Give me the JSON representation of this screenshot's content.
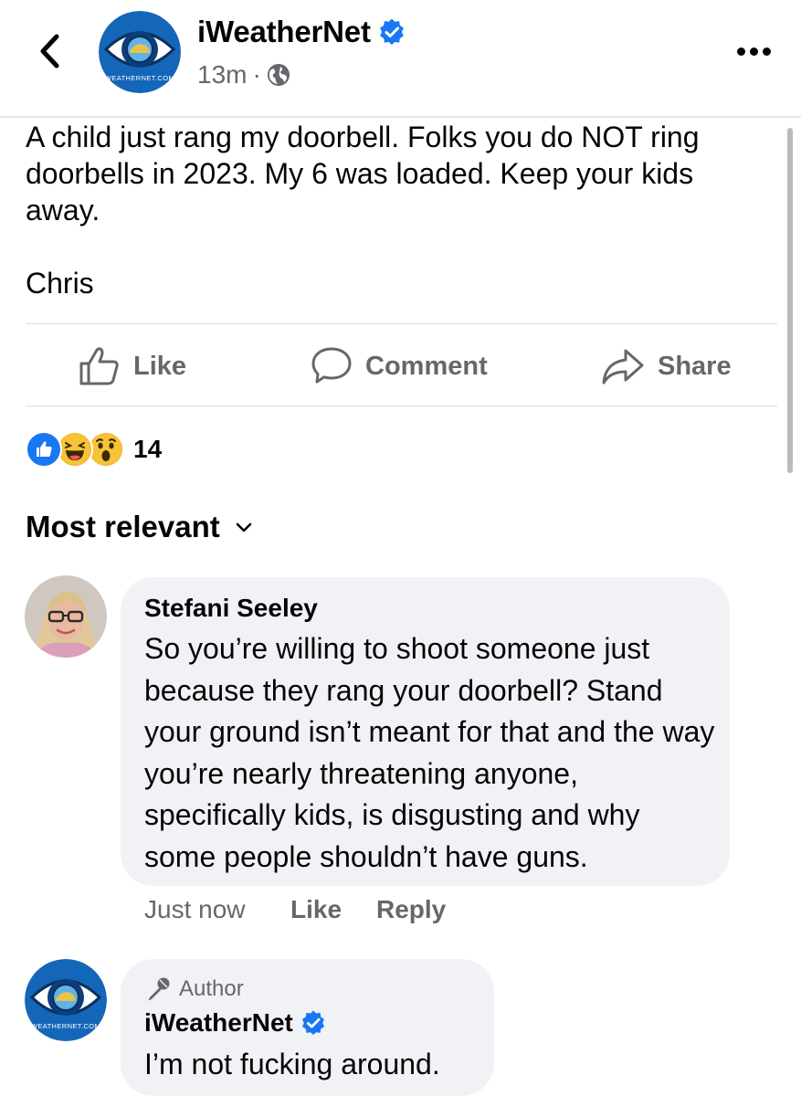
{
  "header": {
    "page_name": "iWeatherNet",
    "verified": true,
    "time": "13m",
    "separator": "·",
    "audience_icon": "globe-icon",
    "avatar_text": "WEATHERNET.COM"
  },
  "post": {
    "text": "A child just rang my doorbell. Folks you do NOT ring doorbells in 2023. My 6 was loaded. Keep your kids away.\n\nChris"
  },
  "actions": {
    "like": "Like",
    "comment": "Comment",
    "share": "Share"
  },
  "reactions": {
    "icons": [
      "like-reaction-icon",
      "haha-reaction-icon",
      "wow-reaction-icon"
    ],
    "count": "14"
  },
  "comments_sort": {
    "label": "Most relevant"
  },
  "comments": [
    {
      "author": "Stefani Seeley",
      "text": "So you’re willing to shoot someone just because they rang your doorbell? Stand your ground isn’t meant for that and the way you’re nearly threatening anyone, specifically kids, is disgusting and why some people shouldn’t have guns.",
      "time": "Just now",
      "like": "Like",
      "reply": "Reply"
    },
    {
      "badge": "Author",
      "author": "iWeatherNet",
      "verified": true,
      "text": "I’m not fucking around."
    }
  ],
  "colors": {
    "verified_blue": "#1877f2",
    "secondary_text": "#65676b",
    "bubble_bg": "#f0f2f5"
  }
}
